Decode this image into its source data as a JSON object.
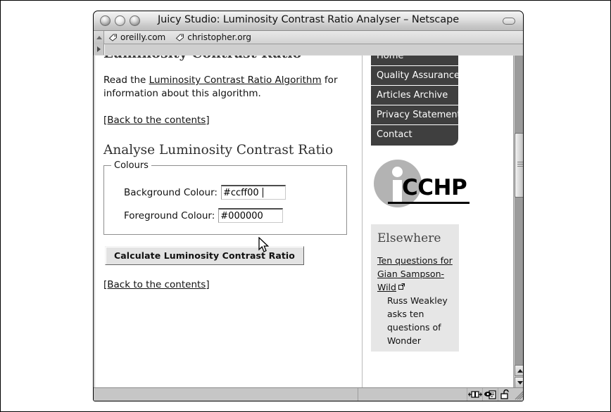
{
  "window": {
    "title": "Juicy Studio: Luminosity Contrast Ratio Analyser – Netscape",
    "close_icon": "close-button",
    "minimize_icon": "minimize-button",
    "zoom_icon": "zoom-button",
    "collapse_icon": "collapse-button"
  },
  "bookmarks": [
    {
      "label": "oreilly.com",
      "icon": "tag-icon"
    },
    {
      "label": "christopher.org",
      "icon": "tag-icon"
    }
  ],
  "page": {
    "clipped_heading": "Luminosity Contrast Ratio",
    "intro_before": "Read the ",
    "intro_link": "Luminosity Contrast Ratio Algorithm",
    "intro_after": " for information about this algorithm.",
    "back_link_top": "[Back to the contents]",
    "section_heading": "Analyse Luminosity Contrast Ratio",
    "fieldset_legend": "Colours",
    "fields": [
      {
        "label": "Background Colour:",
        "value": "#ccff00",
        "focused": true
      },
      {
        "label": "Foreground Colour:",
        "value": "#000000",
        "focused": false
      }
    ],
    "submit_label": "Calculate Luminosity Contrast Ratio",
    "back_link_bottom": "[Back to the contents]"
  },
  "sidebar": {
    "nav": [
      {
        "label": "Home"
      },
      {
        "label": "Quality Assurance"
      },
      {
        "label": "Articles Archive"
      },
      {
        "label": "Privacy Statement"
      },
      {
        "label": "Contact"
      }
    ],
    "logo": {
      "name": "icchp-logo",
      "text": "CCHP",
      "letter": "i"
    },
    "elsewhere": {
      "heading": "Elsewhere",
      "link_text": "Ten questions for Gian Sampson-Wild",
      "external_icon": "external-link-icon",
      "description": "Russ Weakley asks ten questions of Wonder"
    }
  },
  "statusbar": {
    "icons": [
      "network-connection-icon",
      "security-chat-icon",
      "padlock-unlocked-icon",
      "resize-grip-icon"
    ]
  },
  "scrollbar": {
    "up_icon": "scroll-up-arrow-icon",
    "down_icon": "scroll-down-arrow-icon",
    "thumb": "vertical-scroll-thumb"
  },
  "colors": {
    "nav_background": "#3f3f3f",
    "elsewhere_background": "#e6e6e6",
    "logo_circle": "#b3b3b3",
    "chrome": "#c6c6c6"
  }
}
